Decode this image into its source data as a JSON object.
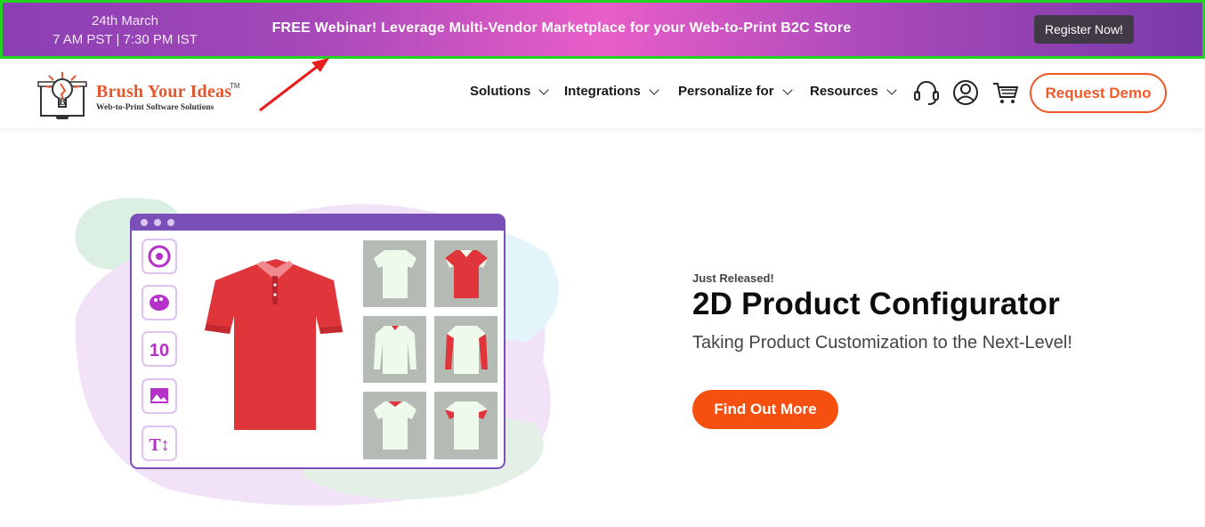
{
  "banner": {
    "date_line1": "24th March",
    "date_line2": "7 AM PST | 7:30 PM IST",
    "title": "FREE Webinar! Leverage Multi-Vendor Marketplace for your Web-to-Print B2C Store",
    "button_label": "Register Now!"
  },
  "header": {
    "logo_name": "Brush Your Ideas",
    "logo_tm": "TM",
    "logo_tagline": "Web-to-Print Software Solutions",
    "nav": [
      {
        "label": "Solutions"
      },
      {
        "label": "Integrations"
      },
      {
        "label": "Personalize for"
      },
      {
        "label": "Resources"
      }
    ],
    "icons": [
      "headset-icon",
      "user-icon",
      "cart-icon"
    ],
    "request_demo_label": "Request Demo"
  },
  "hero": {
    "eyebrow": "Just Released!",
    "headline": "2D Product Configurator",
    "subline": "Taking Product Customization to the Next-Level!",
    "cta_label": "Find Out More",
    "tool_number": "10",
    "tool_text_icon": "T↕"
  },
  "colors": {
    "banner_start": "#8a3fb3",
    "banner_mid": "#e85ec8",
    "banner_border": "#22d422",
    "accent_orange": "#f05a28",
    "cta_orange": "#f5500f",
    "shirt_red": "#e0353b",
    "panel_purple": "#7b4fb8"
  }
}
